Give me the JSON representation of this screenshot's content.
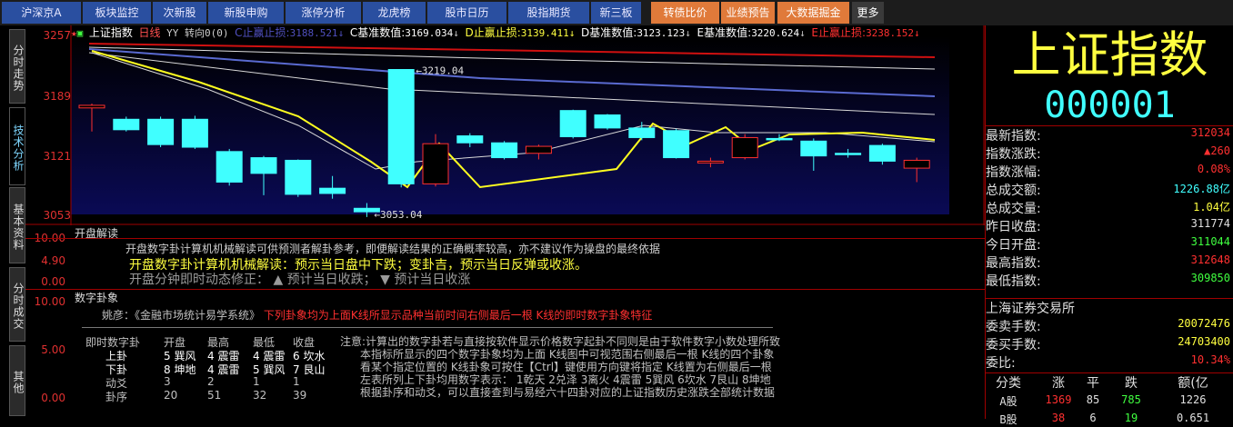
{
  "tabs": [
    {
      "label": "沪深京A",
      "hl": false
    },
    {
      "label": "板块监控",
      "hl": false
    },
    {
      "label": "次新股",
      "hl": false
    },
    {
      "label": "新股申购",
      "hl": false
    },
    {
      "label": "涨停分析",
      "hl": false
    },
    {
      "label": "龙虎榜",
      "hl": false
    },
    {
      "label": "股市日历",
      "hl": false
    },
    {
      "label": "股指期货",
      "hl": false
    },
    {
      "label": "新三板",
      "hl": false
    },
    {
      "label": "转债比价",
      "hl": true
    },
    {
      "label": "业绩预告",
      "hl": true
    },
    {
      "label": "大数据掘金",
      "hl": true
    },
    {
      "label": "更多",
      "hl": false
    }
  ],
  "side_tabs": [
    "分时走势",
    "技术分析",
    "基本资料",
    "分时成交",
    "其他"
  ],
  "legend": {
    "name": "上证指数",
    "period": "日线",
    "extra": "YY 转向0(0)",
    "c_label": "C止赢止损:",
    "c_val": "3188.521",
    "cb_label": "C基准数值:",
    "cb_val": "3169.034",
    "d_label": "D止赢止损:",
    "d_val": "3139.411",
    "db_label": "D基准数值:",
    "db_val": "3123.123",
    "eb_label": "E基准数值:",
    "eb_val": "3220.624",
    "e_label": "E止赢止损:",
    "e_val": "3238.152"
  },
  "price_axis": [
    "3257",
    "3189",
    "3121",
    "3053"
  ],
  "annotations": {
    "high": "3219.04",
    "low": "3053.04"
  },
  "kline": [
    {
      "o": 3175,
      "c": 3178,
      "h": 3180,
      "l": 3148
    },
    {
      "o": 3162,
      "c": 3150,
      "h": 3165,
      "l": 3148
    },
    {
      "o": 3162,
      "c": 3133,
      "h": 3165,
      "l": 3130
    },
    {
      "o": 3162,
      "c": 3130,
      "h": 3166,
      "l": 3128
    },
    {
      "o": 3125,
      "c": 3090,
      "h": 3128,
      "l": 3086
    },
    {
      "o": 3118,
      "c": 3100,
      "h": 3120,
      "l": 3075
    },
    {
      "o": 3115,
      "c": 3076,
      "h": 3116,
      "l": 3073
    },
    {
      "o": 3083,
      "c": 3077,
      "h": 3097,
      "l": 3071
    },
    {
      "o": 3060,
      "c": 3056,
      "h": 3066,
      "l": 3050
    },
    {
      "o": 3219,
      "c": 3088,
      "h": 3219,
      "l": 3084
    },
    {
      "o": 3088,
      "c": 3134,
      "h": 3145,
      "l": 3085
    },
    {
      "o": 3143,
      "c": 3135,
      "h": 3146,
      "l": 3130
    },
    {
      "o": 3135,
      "c": 3118,
      "h": 3137,
      "l": 3116
    },
    {
      "o": 3123,
      "c": 3131,
      "h": 3133,
      "l": 3116
    },
    {
      "o": 3172,
      "c": 3142,
      "h": 3173,
      "l": 3140
    },
    {
      "o": 3167,
      "c": 3152,
      "h": 3168,
      "l": 3150
    },
    {
      "o": 3152,
      "c": 3141,
      "h": 3159,
      "l": 3138
    },
    {
      "o": 3149,
      "c": 3118,
      "h": 3151,
      "l": 3117
    },
    {
      "o": 3112,
      "c": 3114,
      "h": 3118,
      "l": 3107
    },
    {
      "o": 3118,
      "c": 3141,
      "h": 3145,
      "l": 3116
    },
    {
      "o": 3140,
      "c": 3139,
      "h": 3145,
      "l": 3137
    },
    {
      "o": 3137,
      "c": 3120,
      "h": 3140,
      "l": 3103
    },
    {
      "o": 3123,
      "c": 3122,
      "h": 3128,
      "l": 3118
    },
    {
      "o": 3132,
      "c": 3114,
      "h": 3134,
      "l": 3110
    },
    {
      "o": 3106,
      "c": 3115,
      "h": 3118,
      "l": 3090
    }
  ],
  "kaipan": {
    "title": "开盘解读",
    "axis": [
      "10.00",
      "4.90",
      "0.00"
    ],
    "line1": "开盘数字卦计算机机械解读可供预测者解卦参考，即便解读结果的正确概率较高，亦不建议作为操盘的最终依据",
    "line2": "开盘数字卦计算机机械解读：预示当日盘中下跌；变卦吉，预示当日反弹或收涨。",
    "line3": "开盘分钟即时动态修正：  ▲ 预计当日收跌； ▼ 预计当日收涨"
  },
  "shuzi": {
    "title": "数字卦象",
    "axis": [
      "10.00",
      "5.00",
      "0.00"
    ],
    "source_prefix": "姚彦：《金融市场统计易学系统》",
    "source_red": "下列卦象均为上面K线所显示品种当前时间右侧最后一根  K线的即时数字卦象特征",
    "headers": [
      "即时数字卦",
      "开盘",
      "最高",
      "最低",
      "收盘"
    ],
    "rows": [
      {
        "name": "上卦",
        "c": [
          "5 巽风",
          "4 震雷",
          "4 震雷",
          "6 坎水"
        ]
      },
      {
        "name": "下卦",
        "c": [
          "8 坤地",
          "4 震雷",
          "5 巽风",
          "7 艮山"
        ]
      },
      {
        "name": "动爻",
        "c": [
          "3",
          "2",
          "1",
          "1"
        ]
      },
      {
        "name": "卦序",
        "c": [
          "20",
          "51",
          "32",
          "39"
        ]
      }
    ],
    "note": [
      "注意:计算出的数字卦若与直接按软件显示价格数字起卦不同则是由于软件数字小数处理所致",
      "本指标所显示的四个数字卦象均为上面  K线图中可视范围右侧最后一根  K线的四个卦象",
      "看某个指定位置的  K线卦象可按住【Ctrl】键使用方向键将指定  K线置为右侧最后一根",
      "左表所列上下卦均用数字表示：  1乾天 2兑泽 3离火 4震雷 5巽风 6坎水 7艮山 8坤地",
      "根据卦序和动爻，可以直接查到与易经六十四卦对应的上证指数历史涨跌全部统计数据"
    ]
  },
  "right": {
    "name": "上证指数",
    "code": "000001",
    "stats": [
      {
        "k": "最新指数:",
        "v": "312034",
        "color": "#ff3030"
      },
      {
        "k": "指数涨跌:",
        "v": "▲260",
        "color": "#ff3030"
      },
      {
        "k": "指数涨幅:",
        "v": "0.08%",
        "color": "#ff3030"
      },
      {
        "k": "总成交额:",
        "v": "1226.88亿",
        "color": "#40ffff"
      },
      {
        "k": "总成交量:",
        "v": "1.04亿",
        "color": "#ffff40"
      },
      {
        "k": "昨日收盘:",
        "v": "311774",
        "color": "#e0e0e0"
      },
      {
        "k": "今日开盘:",
        "v": "311044",
        "color": "#40ff40"
      },
      {
        "k": "最高指数:",
        "v": "312648",
        "color": "#ff3030"
      },
      {
        "k": "最低指数:",
        "v": "309850",
        "color": "#40ff40"
      }
    ],
    "exchange": "上海证券交易所",
    "stats2": [
      {
        "k": "委卖手数:",
        "v": "20072476",
        "color": "#ffff40"
      },
      {
        "k": "委买手数:",
        "v": "24703400",
        "color": "#ffff40"
      },
      {
        "k": "委比:",
        "v": "10.34%",
        "color": "#ff3030"
      }
    ],
    "table_headers": [
      "分类",
      "涨",
      "平",
      "跌",
      "额(亿"
    ],
    "table_rows": [
      {
        "c": [
          "A股",
          "1369",
          "85",
          "785",
          "1226"
        ]
      },
      {
        "c": [
          "B股",
          "38",
          "6",
          "19",
          "0.651"
        ]
      }
    ]
  }
}
